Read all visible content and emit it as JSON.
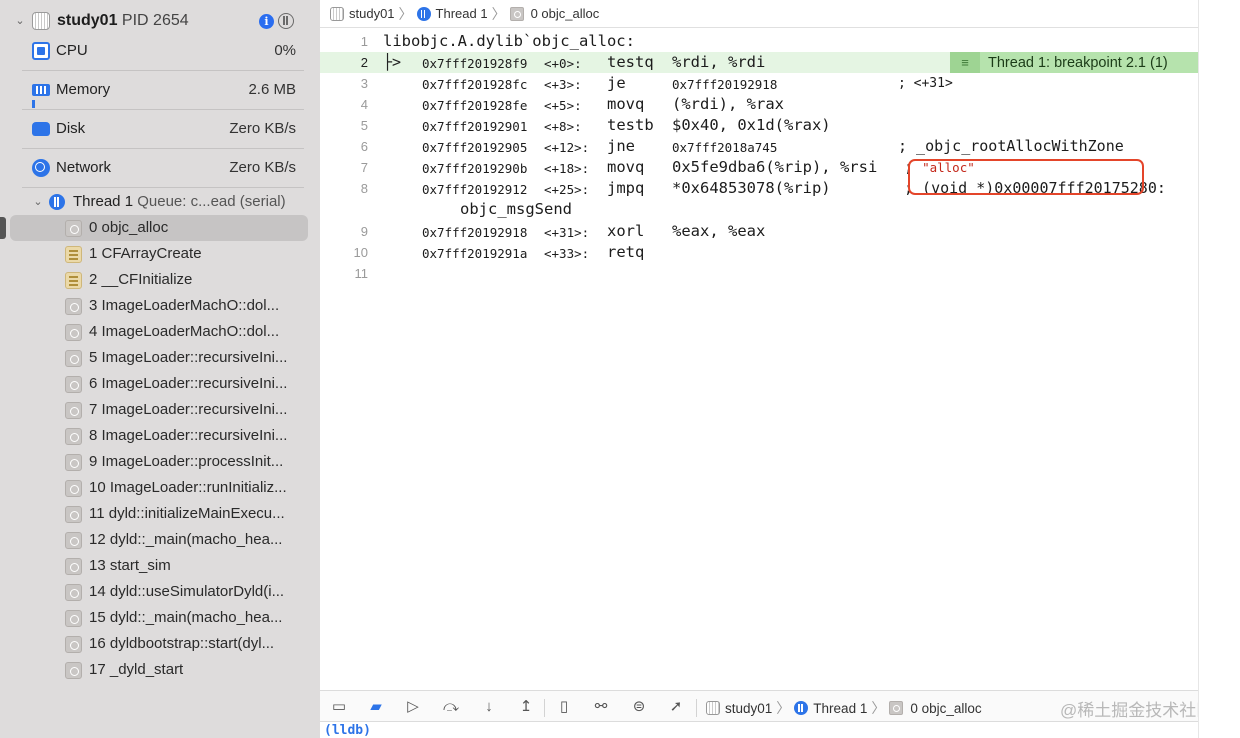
{
  "process": {
    "name": "study01",
    "pid_label": "PID 2654"
  },
  "gauges": [
    {
      "label": "CPU",
      "value": "0%"
    },
    {
      "label": "Memory",
      "value": "2.6 MB"
    },
    {
      "label": "Disk",
      "value": "Zero KB/s"
    },
    {
      "label": "Network",
      "value": "Zero KB/s"
    }
  ],
  "thread": {
    "name": "Thread 1",
    "queue": "Queue: c...ead (serial)"
  },
  "frames": [
    "0 objc_alloc",
    "1 CFArrayCreate",
    "2 __CFInitialize",
    "3 ImageLoaderMachO::dol...",
    "4 ImageLoaderMachO::dol...",
    "5 ImageLoader::recursiveIni...",
    "6 ImageLoader::recursiveIni...",
    "7 ImageLoader::recursiveIni...",
    "8 ImageLoader::recursiveIni...",
    "9 ImageLoader::processInit...",
    "10 ImageLoader::runInitializ...",
    "11 dyld::initializeMainExecu...",
    "12 dyld::_main(macho_hea...",
    "13 start_sim",
    "14 dyld::useSimulatorDyld(i...",
    "15 dyld::_main(macho_hea...",
    "16 dyldbootstrap::start(dyl...",
    "17 _dyld_start"
  ],
  "jumpbar": {
    "process": "study01",
    "thread": "Thread 1",
    "frame": "0 objc_alloc"
  },
  "code": {
    "header": "libobjc.A.dylib`objc_alloc:",
    "pc_arrow": "├>",
    "line_numbers": [
      "1",
      "2",
      "3",
      "4",
      "5",
      "6",
      "7",
      "8",
      "9",
      "10",
      "11"
    ],
    "instructions": [
      {
        "addr": "0x7fff201928f9",
        "off": "<+0>:",
        "mnem": "testq",
        "opnd": "%rdi, %rdi",
        "comment": ""
      },
      {
        "addr": "0x7fff201928fc",
        "off": "<+3>:",
        "mnem": "je",
        "opnd": "0x7fff20192918",
        "comment": "; <+31>"
      },
      {
        "addr": "0x7fff201928fe",
        "off": "<+5>:",
        "mnem": "movq",
        "opnd": "(%rdi), %rax",
        "comment": ""
      },
      {
        "addr": "0x7fff20192901",
        "off": "<+8>:",
        "mnem": "testb",
        "opnd": "$0x40, 0x1d(%rax)",
        "comment": ""
      },
      {
        "addr": "0x7fff20192905",
        "off": "<+12>:",
        "mnem": "jne",
        "opnd": "0x7fff2018a745",
        "comment": "; _objc_rootAllocWithZone"
      },
      {
        "addr": "0x7fff2019290b",
        "off": "<+18>:",
        "mnem": "movq",
        "opnd": "0x5fe9dba6(%rip), %rsi",
        "comment": ";",
        "comment_str": "\"alloc\""
      },
      {
        "addr": "0x7fff20192912",
        "off": "<+25>:",
        "mnem": "jmpq",
        "opnd": "*0x64853078(%rip)",
        "comment": "; (void *)0x00007fff20175280:",
        "wrap": "objc_msgSend"
      },
      {
        "addr": "0x7fff20192918",
        "off": "<+31>:",
        "mnem": "xorl",
        "opnd": "%eax, %eax",
        "comment": ""
      },
      {
        "addr": "0x7fff2019291a",
        "off": "<+33>:",
        "mnem": "retq",
        "opnd": "",
        "comment": ""
      }
    ],
    "breakpoint_badge": "Thread 1: breakpoint 2.1 (1)"
  },
  "debugbar": {
    "process": "study01",
    "thread": "Thread 1",
    "frame": "0 objc_alloc",
    "watermark": "@稀土掘金技术社区"
  },
  "console": {
    "prompt": "(lldb)"
  },
  "icons": [
    "disclosure-down-icon",
    "process-icon",
    "info-icon",
    "threads-icon",
    "cpu-icon",
    "memory-icon",
    "disk-icon",
    "network-icon",
    "thread-icon",
    "frame-icon"
  ],
  "colors": {
    "accent": "#2d74e8",
    "current_line": "#e5f5e3",
    "breakpoint_badge": "#b6e3ad",
    "highlight_box": "#e4452a",
    "string": "#c4291c"
  }
}
